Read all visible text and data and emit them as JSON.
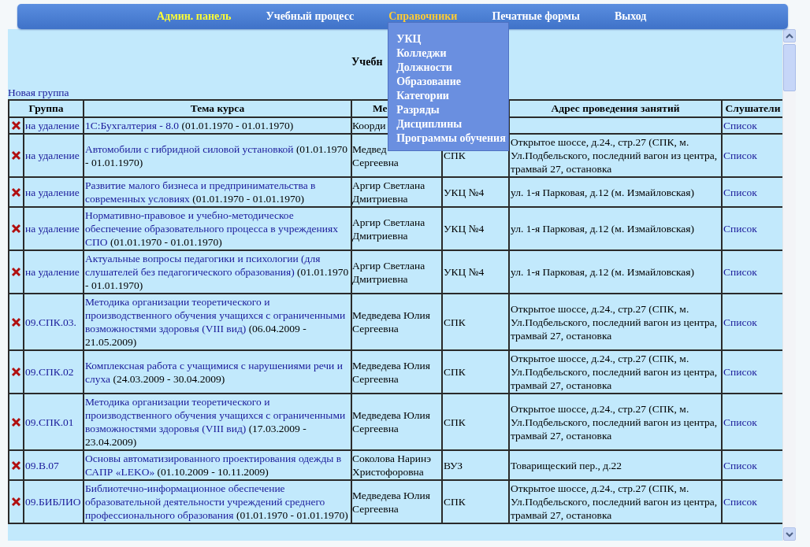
{
  "nav": [
    {
      "label": "Админ. панель",
      "color": "#ffff33"
    },
    {
      "label": "Учебный процесс",
      "color": "#ffffff"
    },
    {
      "label": "Справочники",
      "color": "#ffcc33",
      "menu": [
        "УКЦ",
        "Колледжи",
        "Должности",
        "Образование",
        "Категории",
        "Разряды",
        "Дисциплины",
        "Программы обучения"
      ]
    },
    {
      "label": "Печатные формы",
      "color": "#ffffff"
    },
    {
      "label": "Выход",
      "color": "#ffffff"
    }
  ],
  "heading": "Учебн",
  "new_group_link": "Новая группа",
  "table": {
    "columns": [
      {
        "label": "Группа"
      },
      {
        "label": "Тема курса"
      },
      {
        "label": "Ме"
      },
      {},
      {
        "label": "Адрес проведения занятий"
      },
      {
        "label": "Слушатели"
      }
    ],
    "rows": [
      {
        "group": "на удаление",
        "course": "1С:Бухгалтерия - 8.0",
        "dates": "(01.01.1970 - 01.01.1970)",
        "teacher": "Коорди",
        "listeners": "Список"
      },
      {
        "group": "на удаление",
        "course": "Автомобили с гибридной силовой установкой",
        "dates": "(01.01.1970 - 01.01.1970)",
        "teacher": "Медвед\nСергеевна",
        "place": "СПК",
        "address": "Открытое шоссе, д.24., стр.27 (СПК, м. Ул.Подбельского, последний вагон из центра, трамвай 27, остановка",
        "listeners": "Список"
      },
      {
        "group": "на удаление",
        "course": "Развитие малого бизнеса и предпринимательства в современных условиях",
        "dates": "(01.01.1970 - 01.01.1970)",
        "teacher": "Аргир Светлана Дмитриевна",
        "place": "УКЦ №4",
        "address": "ул. 1-я Парковая, д.12 (м. Измайловская)",
        "listeners": "Список"
      },
      {
        "group": "на удаление",
        "course": "Нормативно-правовое и учебно-методическое обеспечение образовательного процесса в учреждениях СПО",
        "dates": "(01.01.1970 - 01.01.1970)",
        "teacher": "Аргир Светлана Дмитриевна",
        "place": "УКЦ №4",
        "address": "ул. 1-я Парковая, д.12 (м. Измайловская)",
        "listeners": "Список"
      },
      {
        "group": "на удаление",
        "course": "Актуальные вопросы педагогики и психологии (для слушателей без педагогического образования)",
        "dates": "(01.01.1970 - 01.01.1970)",
        "teacher": "Аргир Светлана Дмитриевна",
        "place": "УКЦ №4",
        "address": "ул. 1-я Парковая, д.12 (м. Измайловская)",
        "listeners": "Список"
      },
      {
        "group": "09.СПК.03.",
        "course": "Методика организации теоретического и производственного обучения учащихся с ограниченными возможностями здоровья (VIII вид)",
        "dates": "(06.04.2009 - 21.05.2009)",
        "teacher": "Медведева Юлия Сергеевна",
        "place": "СПК",
        "address": "Открытое шоссе, д.24., стр.27 (СПК, м. Ул.Подбельского, последний вагон из центра, трамвай 27, остановка",
        "listeners": "Список"
      },
      {
        "group": "09.СПК.02",
        "course": "Комплексная работа с учащимися с нарушениями речи и слуха",
        "dates": "(24.03.2009 - 30.04.2009)",
        "teacher": "Медведева Юлия Сергеевна",
        "place": "СПК",
        "address": "Открытое шоссе, д.24., стр.27 (СПК, м. Ул.Подбельского, последний вагон из центра, трамвай 27, остановка",
        "listeners": "Список"
      },
      {
        "group": "09.СПК.01",
        "course": "Методика организации теоретического и производственного обучения учащихся с ограниченными возможностями здоровья (VIII вид)",
        "dates": "(17.03.2009 - 23.04.2009)",
        "teacher": "Медведева Юлия Сергеевна",
        "place": "СПК",
        "address": "Открытое шоссе, д.24., стр.27 (СПК, м. Ул.Подбельского, последний вагон из центра, трамвай 27, остановка",
        "listeners": "Список"
      },
      {
        "group": "09.В.07",
        "course": "Основы автоматизированного проектирования одежды в САПР «LEKO»",
        "dates": "(01.10.2009 - 10.11.2009)",
        "teacher": "Соколова Наринэ Христофоровна",
        "place": "ВУЗ",
        "address": "Товарищеский пер., д.22",
        "listeners": "Список"
      },
      {
        "group": "09.БИБЛИО",
        "course": "Библиотечно-информационное обеспечение образовательной деятельности учреждений среднего профессионального образования",
        "dates": "(01.01.1970 - 01.01.1970)",
        "teacher": "Медведева Юлия Сергеевна",
        "place": "СПК",
        "address": "Открытое шоссе, д.24., стр.27 (СПК, м. Ул.Подбельского, последний вагон из центра, трамвай 27, остановка",
        "listeners": "Список"
      }
    ]
  }
}
